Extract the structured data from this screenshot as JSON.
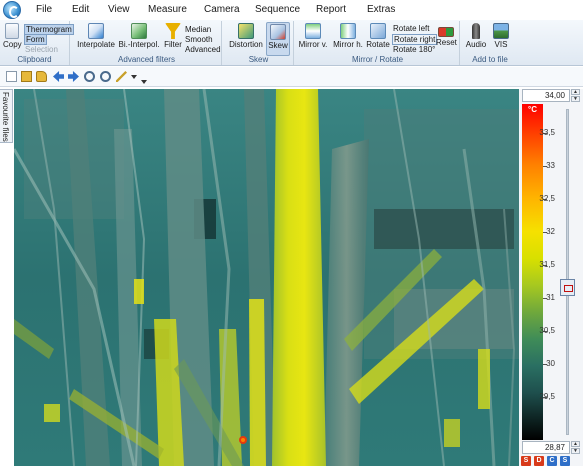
{
  "menu": [
    "File",
    "Edit",
    "View",
    "Measure",
    "Camera",
    "Sequence",
    "Report",
    "Extras"
  ],
  "ribbon": {
    "clipboard": {
      "label": "Clipboard",
      "copy": "Copy",
      "opt1": "Thermogram",
      "opt2": "Form",
      "opt3": "Selection"
    },
    "advanced_filters": {
      "label": "Advanced filters",
      "interpolate": "Interpolate",
      "bi_interpol": "Bi.-Interpol.",
      "filter": "Filter",
      "median": "Median",
      "smooth": "Smooth",
      "advanced": "Advanced"
    },
    "skew": {
      "label": "Skew",
      "distortion": "Distortion",
      "skew": "Skew"
    },
    "mirror_rotate": {
      "label": "Mirror / Rotate",
      "mirror_v": "Mirror v.",
      "mirror_h": "Mirror h.",
      "rotate": "Rotate",
      "rotate_left": "Rotate left",
      "rotate_right": "Rotate right",
      "rotate_180": "Rotate 180°",
      "reset": "Reset"
    },
    "add_to_file": {
      "label": "Add to file",
      "audio": "Audio",
      "vis": "VIS"
    }
  },
  "side_tab": "Favourite files",
  "scale": {
    "max_value": "34,00",
    "min_value": "28,87",
    "unit": "°C",
    "ticks": [
      "33,5",
      "33",
      "32,5",
      "32",
      "31,5",
      "31",
      "30,5",
      "30",
      "29,5"
    ],
    "palette_buttons": [
      {
        "label": "S",
        "color": "#d83a1a"
      },
      {
        "label": "D",
        "color": "#d83a1a"
      },
      {
        "label": "C",
        "color": "#2f6fc8"
      },
      {
        "label": "S",
        "color": "#2f6fc8"
      }
    ]
  }
}
